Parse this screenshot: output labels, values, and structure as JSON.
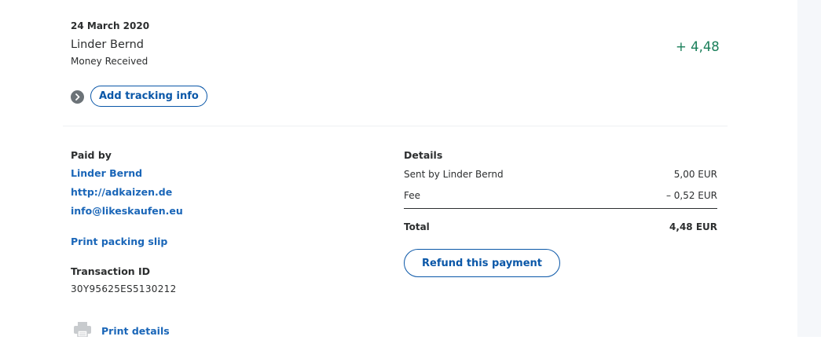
{
  "transaction": {
    "date": "24 March 2020",
    "counterparty": "Linder Bernd",
    "type": "Money Received",
    "amount": "+ 4,48",
    "add_tracking_label": "Add tracking info"
  },
  "paid_by": {
    "heading": "Paid by",
    "name": "Linder Bernd",
    "website": "http://adkaizen.de",
    "email": "info@likeskaufen.eu",
    "print_packing_slip": "Print packing slip",
    "transaction_id_label": "Transaction ID",
    "transaction_id": "30Y95625ES5130212",
    "print_details": "Print details"
  },
  "details": {
    "heading": "Details",
    "rows": [
      {
        "label": "Sent by Linder Bernd",
        "value": "5,00 EUR"
      },
      {
        "label": "Fee",
        "value": "– 0,52 EUR"
      }
    ],
    "total_label": "Total",
    "total_value": "4,48 EUR",
    "refund_label": "Refund this payment"
  },
  "colors": {
    "amount_positive": "#1a7f5a",
    "link": "#1a66b8",
    "button_border": "#0a57a8"
  },
  "icons": [
    "chevron-right-icon",
    "printer-icon"
  ]
}
